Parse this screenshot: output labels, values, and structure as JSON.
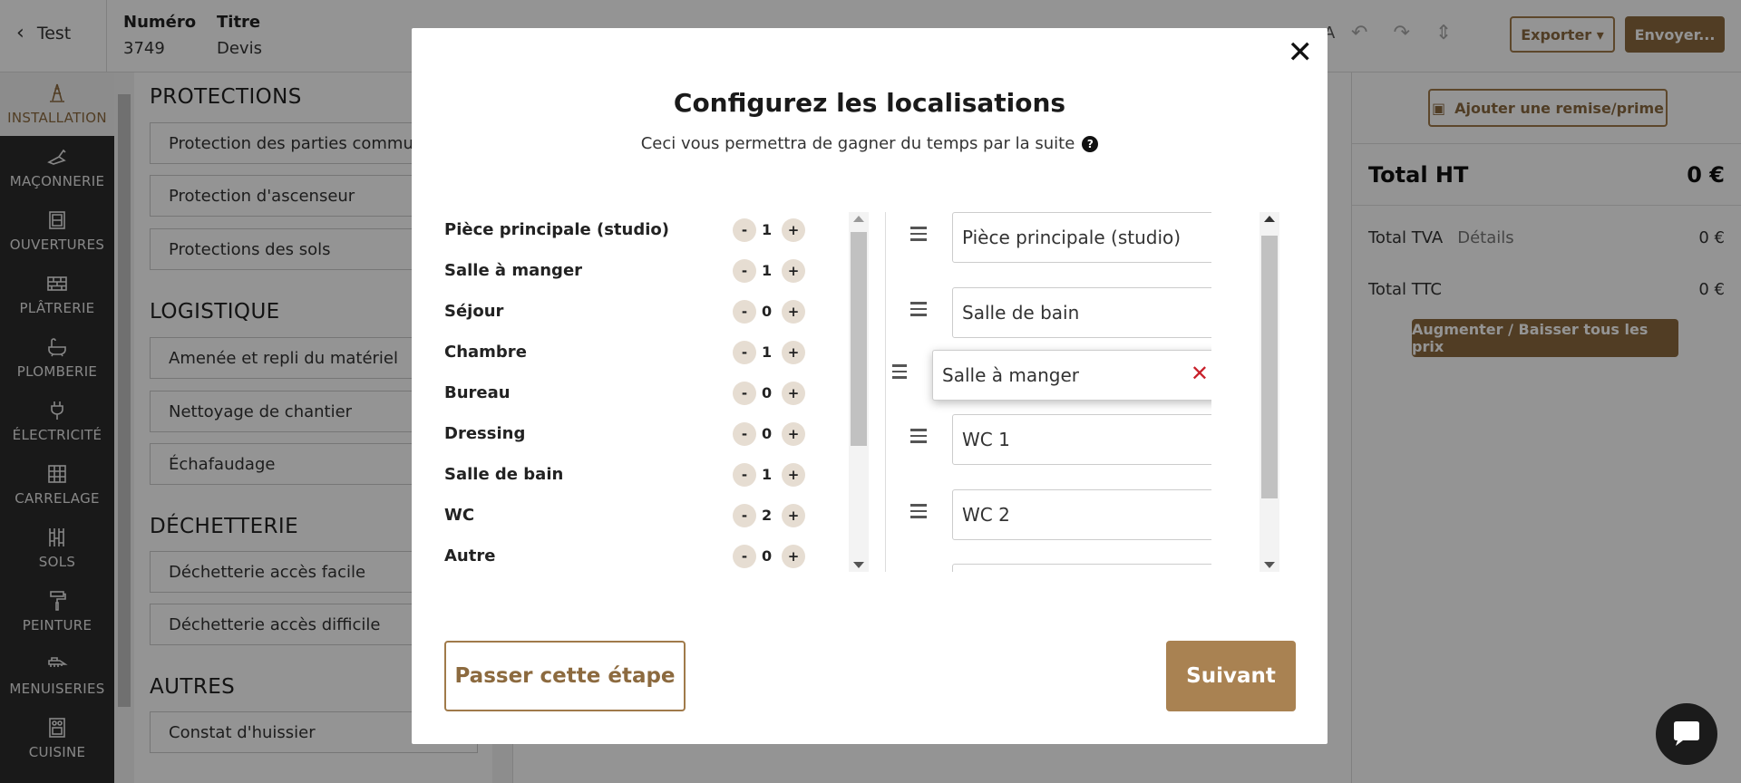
{
  "header": {
    "back_label": "Test",
    "numero_label": "Numéro",
    "numero_value": "3749",
    "titre_label": "Titre",
    "titre_value": "Devis",
    "ttca_label": "A",
    "export_label": "Exporter ▾",
    "send_label": "Envoyer..."
  },
  "sidebar": {
    "items": [
      {
        "label": "INSTALLATION",
        "icon": "cone-icon"
      },
      {
        "label": "MAÇONNERIE",
        "icon": "trowel-icon"
      },
      {
        "label": "OUVERTURES",
        "icon": "door-icon"
      },
      {
        "label": "PLÂTRERIE",
        "icon": "brick-icon"
      },
      {
        "label": "PLOMBERIE",
        "icon": "bathtub-icon"
      },
      {
        "label": "ÉLECTRICITÉ",
        "icon": "plug-icon"
      },
      {
        "label": "CARRELAGE",
        "icon": "tile-icon"
      },
      {
        "label": "SOLS",
        "icon": "floor-icon"
      },
      {
        "label": "PEINTURE",
        "icon": "paint-roller-icon"
      },
      {
        "label": "MENUISERIES",
        "icon": "saw-icon"
      },
      {
        "label": "CUISINE",
        "icon": "stove-icon"
      }
    ]
  },
  "catalog": {
    "sections": [
      {
        "title": "PROTECTIONS",
        "items": [
          "Protection des parties communes",
          "Protection d'ascenseur",
          "Protections des sols"
        ]
      },
      {
        "title": "LOGISTIQUE",
        "items": [
          "Amenée et repli du matériel",
          "Nettoyage de chantier",
          "Échafaudage"
        ]
      },
      {
        "title": "DÉCHETTERIE",
        "items": [
          "Déchetterie accès facile",
          "Déchetterie accès difficile"
        ]
      },
      {
        "title": "AUTRES",
        "items": [
          "Constat d'huissier"
        ]
      }
    ]
  },
  "right_panel": {
    "discount_label": "Ajouter une remise/prime",
    "total_ht_label": "Total HT",
    "total_ht_value": "0 €",
    "total_tva_label": "Total TVA",
    "details_label": "Détails",
    "total_tva_value": "0 €",
    "total_ttc_label": "Total TTC",
    "total_ttc_value": "0 €",
    "adjust_prices_label": "Augmenter / Baisser tous les prix"
  },
  "modal": {
    "title": "Configurez les localisations",
    "subtitle": "Ceci vous permettra de gagner du temps par la suite",
    "counters": [
      {
        "name": "Pièce principale (studio)",
        "count": "1"
      },
      {
        "name": "Salle à manger",
        "count": "1"
      },
      {
        "name": "Séjour",
        "count": "0"
      },
      {
        "name": "Chambre",
        "count": "1"
      },
      {
        "name": "Bureau",
        "count": "0"
      },
      {
        "name": "Dressing",
        "count": "0"
      },
      {
        "name": "Salle de bain",
        "count": "1"
      },
      {
        "name": "WC",
        "count": "2"
      },
      {
        "name": "Autre",
        "count": "0"
      }
    ],
    "minus_symbol": "-",
    "plus_symbol": "+",
    "locations": [
      "Pièce principale (studio)",
      "Salle de bain",
      "Salle à manger",
      "WC 1",
      "WC 2",
      ""
    ],
    "skip_label": "Passer cette étape",
    "next_label": "Suivant"
  },
  "colors": {
    "brand": "#8c6a3f",
    "delete": "#c8202a",
    "sidebar_bg": "#2c2c2c"
  }
}
